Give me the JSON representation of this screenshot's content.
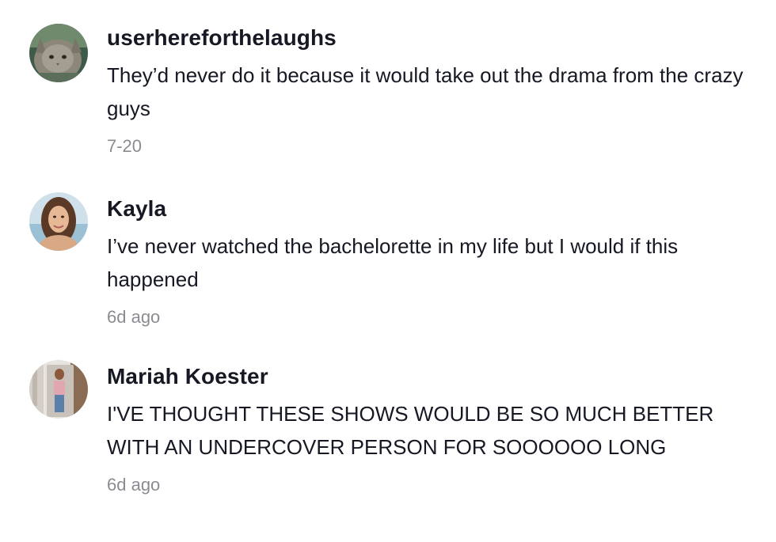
{
  "comments": [
    {
      "username": "userhereforthelaughs",
      "text": "They’d never do it because it would take out the drama from the crazy guys",
      "time": "7-20",
      "avatar_icon": "cat-avatar"
    },
    {
      "username": "Kayla",
      "text": "I’ve never watched the bachelorette in my life but I would if this happened",
      "time": "6d ago",
      "avatar_icon": "woman-avatar"
    },
    {
      "username": "Mariah Koester",
      "text": "I'VE THOUGHT THESE SHOWS WOULD BE SO MUCH BETTER WITH AN UNDERCOVER PERSON FOR SOOOOOO LONG",
      "time": "6d ago",
      "avatar_icon": "mirror-selfie-avatar"
    }
  ],
  "colors": {
    "text": "#161823",
    "time": "#8a8b91"
  }
}
